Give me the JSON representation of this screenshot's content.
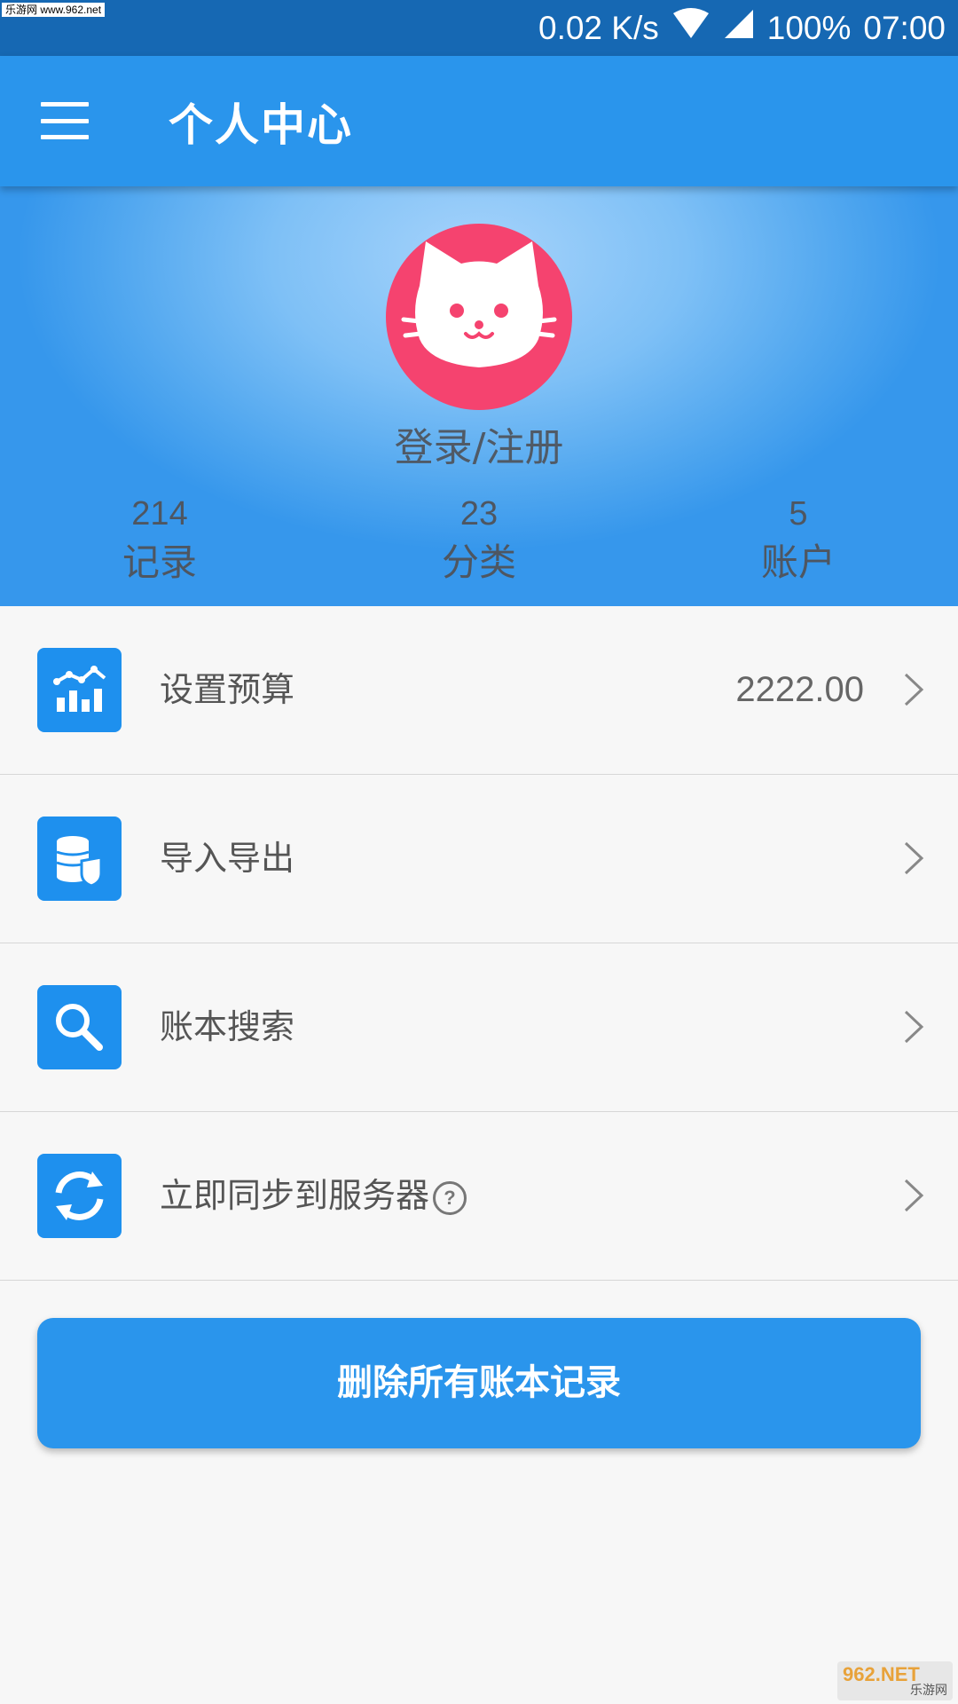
{
  "status_bar": {
    "watermark": "乐游网 www.962.net",
    "speed": "0.02 K/s",
    "battery": "100%",
    "time": "07:00",
    "icons": [
      "wifi-icon",
      "signal-icon"
    ]
  },
  "app_bar": {
    "title": "个人中心",
    "menu_icon": "hamburger-menu-icon"
  },
  "profile": {
    "avatar_icon": "cat-avatar-icon",
    "login_label": "登录/注册",
    "stats": [
      {
        "value": "214",
        "label": "记录"
      },
      {
        "value": "23",
        "label": "分类"
      },
      {
        "value": "5",
        "label": "账户"
      }
    ]
  },
  "menu": [
    {
      "label": "设置预算",
      "value": "2222.00",
      "icon": "budget-chart-icon"
    },
    {
      "label": "导入导出",
      "value": "",
      "icon": "database-shield-icon"
    },
    {
      "label": "账本搜索",
      "value": "",
      "icon": "search-icon"
    },
    {
      "label": "立即同步到服务器",
      "value": "",
      "icon": "sync-icon",
      "help": "?"
    }
  ],
  "delete_button": {
    "label": "删除所有账本记录"
  },
  "bottom_watermark": {
    "text": "962.NET",
    "subtext": "乐游网"
  },
  "colors": {
    "primary": "#2a95ec",
    "status_bar": "#1668b3",
    "avatar": "#f5436f",
    "background": "#f7f7f7"
  }
}
